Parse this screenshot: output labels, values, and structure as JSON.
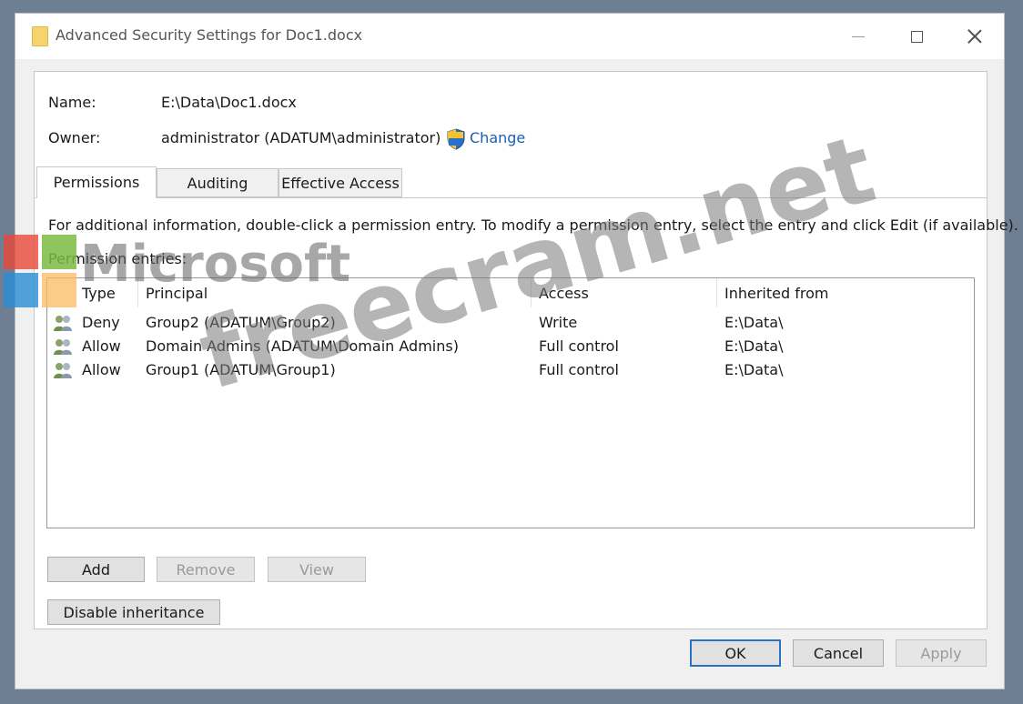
{
  "window": {
    "title": "Advanced Security Settings for Doc1.docx"
  },
  "info": {
    "name_label": "Name:",
    "name_value": "E:\\Data\\Doc1.docx",
    "owner_label": "Owner:",
    "owner_value": "administrator  (ADATUM\\administrator)",
    "change_link": "Change"
  },
  "tabs": [
    {
      "label": "Permissions",
      "active": true
    },
    {
      "label": "Auditing",
      "active": false
    },
    {
      "label": "Effective Access",
      "active": false
    }
  ],
  "instructions": "For additional information, double-click a permission entry. To modify a permission entry, select the entry and click Edit (if available).",
  "entries_label": "Permission entries:",
  "table": {
    "columns": [
      "Type",
      "Principal",
      "Access",
      "Inherited from"
    ],
    "rows": [
      {
        "type": "Deny",
        "principal": "Group2 (ADATUM\\Group2)",
        "access": "Write",
        "inherited": "E:\\Data\\"
      },
      {
        "type": "Allow",
        "principal": "Domain Admins (ADATUM\\Domain  Admins)",
        "access": "Full control",
        "inherited": "E:\\Data\\"
      },
      {
        "type": "Allow",
        "principal": "Group1 (ADATUM\\Group1)",
        "access": "Full control",
        "inherited": "E:\\Data\\"
      }
    ]
  },
  "buttons": {
    "add": "Add",
    "remove": "Remove",
    "view": "View",
    "disable_inheritance": "Disable inheritance",
    "ok": "OK",
    "cancel": "Cancel",
    "apply": "Apply"
  },
  "watermark": {
    "microsoft": "Microsoft",
    "site": "freecram.net"
  },
  "colors": {
    "accent": "#2a73c6",
    "link": "#1a5fb4"
  }
}
